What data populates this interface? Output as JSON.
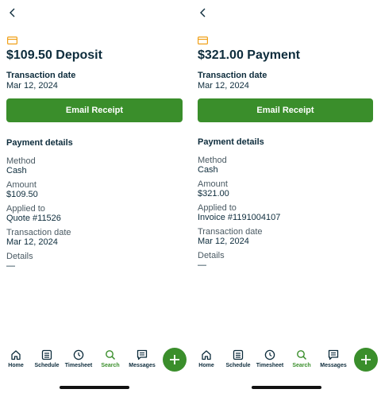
{
  "colors": {
    "accent": "#3a8e2b",
    "text": "#0d2c3c",
    "muted": "#4a5a63",
    "icon_amber": "#f0a11a"
  },
  "screens": [
    {
      "title": "$109.50 Deposit",
      "transaction_date_label": "Transaction date",
      "transaction_date_value": "Mar 12, 2024",
      "email_button": "Email Receipt",
      "section_title": "Payment details",
      "fields": [
        {
          "label": "Method",
          "value": "Cash"
        },
        {
          "label": "Amount",
          "value": "$109.50"
        },
        {
          "label": "Applied to",
          "value": "Quote #11526"
        },
        {
          "label": "Transaction date",
          "value": "Mar 12, 2024"
        },
        {
          "label": "Details",
          "value": "—"
        }
      ]
    },
    {
      "title": "$321.00 Payment",
      "transaction_date_label": "Transaction date",
      "transaction_date_value": "Mar 12, 2024",
      "email_button": "Email Receipt",
      "section_title": "Payment details",
      "fields": [
        {
          "label": "Method",
          "value": "Cash"
        },
        {
          "label": "Amount",
          "value": "$321.00"
        },
        {
          "label": "Applied to",
          "value": "Invoice #1191004107"
        },
        {
          "label": "Transaction date",
          "value": "Mar 12, 2024"
        },
        {
          "label": "Details",
          "value": "—"
        }
      ]
    }
  ],
  "tabbar": {
    "items": [
      {
        "label": "Home",
        "icon": "home-icon",
        "active": false
      },
      {
        "label": "Schedule",
        "icon": "schedule-icon",
        "active": false
      },
      {
        "label": "Timesheet",
        "icon": "clock-icon",
        "active": false
      },
      {
        "label": "Search",
        "icon": "search-icon",
        "active": true
      },
      {
        "label": "Messages",
        "icon": "messages-icon",
        "active": false
      }
    ],
    "fab_icon": "plus-icon"
  }
}
